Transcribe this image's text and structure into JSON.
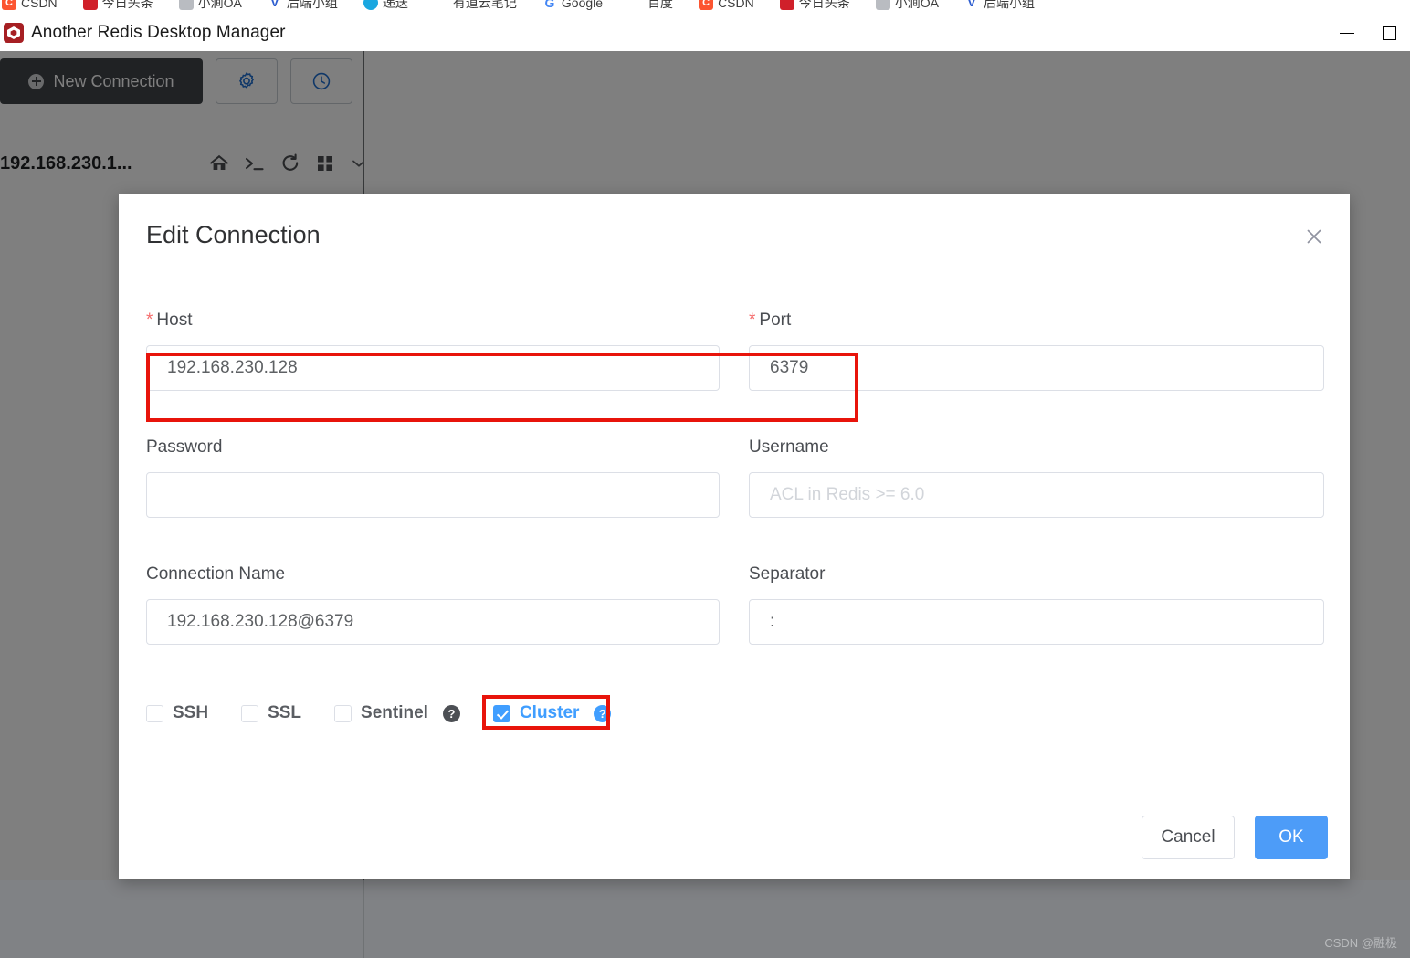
{
  "browser_bookmarks": [
    {
      "label": "CSDN",
      "icon": "csdn-icon"
    },
    {
      "label": "今日头条",
      "icon": "red-square-icon"
    },
    {
      "label": "小涧OA",
      "icon": "gray-square-icon"
    },
    {
      "label": "后端小组",
      "icon": "v-logo-icon"
    },
    {
      "label": "递送",
      "icon": "cyan-circle-icon"
    },
    {
      "label": "有道云笔记",
      "icon": "navy-square-icon"
    },
    {
      "label": "Google",
      "icon": "google-icon"
    },
    {
      "label": "百度",
      "icon": "baidu-icon"
    },
    {
      "label": "CSDN",
      "icon": "csdn-icon"
    },
    {
      "label": "今日头条",
      "icon": "red-square-icon"
    },
    {
      "label": "小涧OA",
      "icon": "gray-square-icon"
    },
    {
      "label": "后端小组",
      "icon": "v-logo-icon"
    }
  ],
  "window": {
    "title": "Another Redis Desktop Manager",
    "app_icon": "redis-logo-icon",
    "minimize": "minimize-icon",
    "maximize": "maximize-icon"
  },
  "sidebar": {
    "new_connection_label": "New Connection",
    "new_connection_icon": "plus-circle-icon",
    "settings_icon": "gear-icon",
    "history_icon": "clock-icon",
    "connection": {
      "name": "192.168.230.1...",
      "icons": [
        "home-icon",
        "terminal-icon",
        "refresh-icon",
        "grid-icon",
        "chevron-down-icon"
      ]
    }
  },
  "dialog": {
    "title": "Edit Connection",
    "close_icon": "close-icon",
    "fields": {
      "host": {
        "label": "Host",
        "required_mark": "*",
        "value": "192.168.230.128",
        "placeholder": ""
      },
      "port": {
        "label": "Port",
        "required_mark": "*",
        "value": "6379",
        "placeholder": ""
      },
      "password": {
        "label": "Password",
        "value": "",
        "placeholder": ""
      },
      "username": {
        "label": "Username",
        "value": "",
        "placeholder": "ACL in Redis >= 6.0"
      },
      "connection_name": {
        "label": "Connection Name",
        "value": "192.168.230.128@6379",
        "placeholder": ""
      },
      "separator": {
        "label": "Separator",
        "value": ":",
        "placeholder": ""
      }
    },
    "checkboxes": [
      {
        "label": "SSH",
        "checked": false,
        "help": false
      },
      {
        "label": "SSL",
        "checked": false,
        "help": false
      },
      {
        "label": "Sentinel",
        "checked": false,
        "help": true,
        "help_glyph": "?"
      },
      {
        "label": "Cluster",
        "checked": true,
        "help": true,
        "help_glyph": "?"
      }
    ],
    "buttons": {
      "cancel": "Cancel",
      "ok": "OK"
    }
  },
  "annotations": [
    {
      "name": "host-port-highlight",
      "color": "#e8140b"
    },
    {
      "name": "cluster-highlight",
      "color": "#e8140b"
    }
  ],
  "watermark": "CSDN @融极",
  "colors": {
    "accent_blue": "#409eff",
    "ok_button": "#4d9cf8",
    "annotation_red": "#e8140b",
    "required_red": "#f56c6c",
    "sidebar_button": "#404448"
  }
}
